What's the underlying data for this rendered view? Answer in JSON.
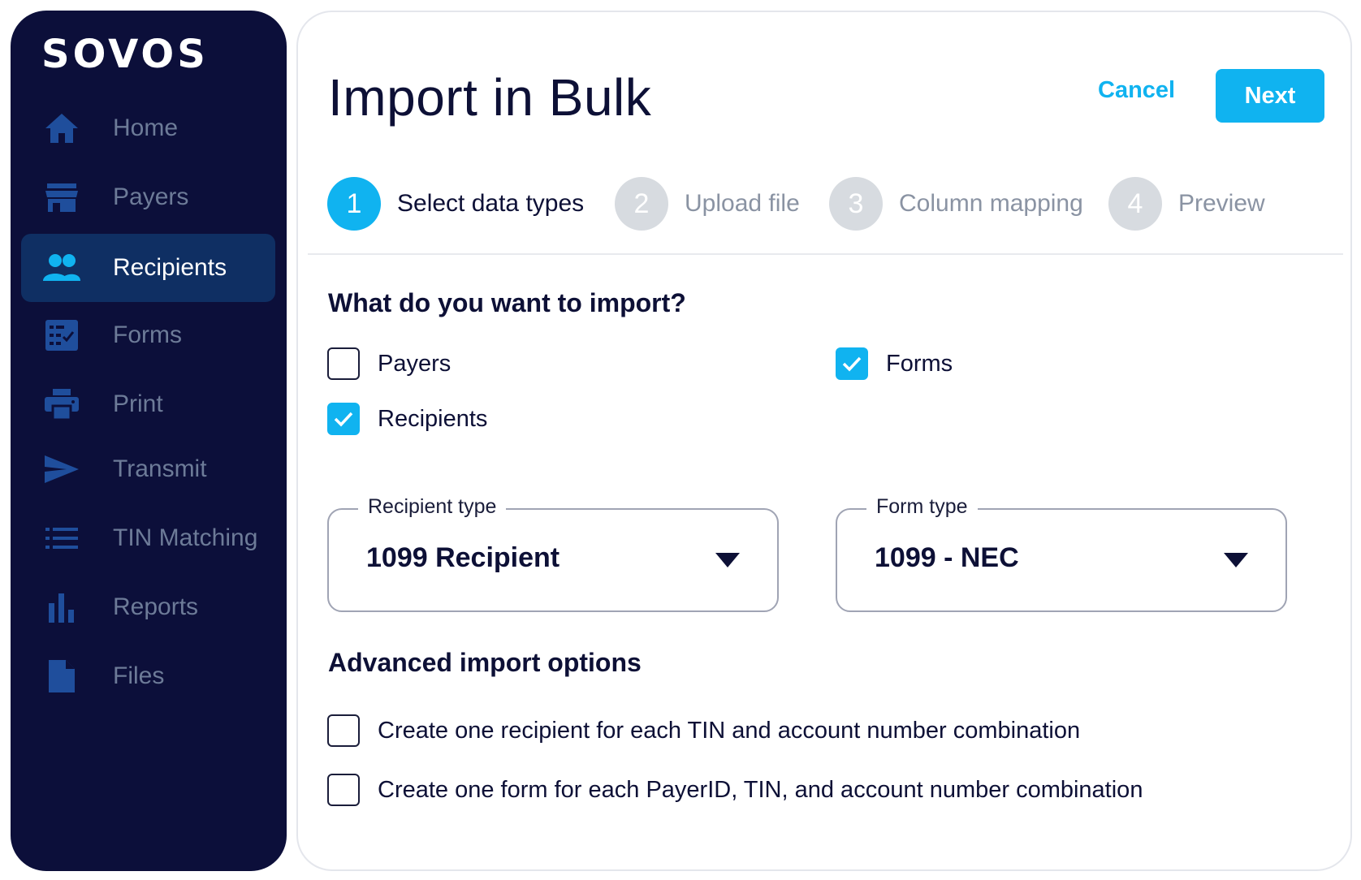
{
  "brand": {
    "logo_text": "SOVOS"
  },
  "sidebar": {
    "items": [
      {
        "label": "Home",
        "icon": "home-icon",
        "active": false
      },
      {
        "label": "Payers",
        "icon": "store-icon",
        "active": false
      },
      {
        "label": "Recipients",
        "icon": "people-icon",
        "active": true
      },
      {
        "label": "Forms",
        "icon": "checklist-icon",
        "active": false
      },
      {
        "label": "Print",
        "icon": "printer-icon",
        "active": false
      },
      {
        "label": "Transmit",
        "icon": "send-icon",
        "active": false
      },
      {
        "label": "TIN Matching",
        "icon": "list-icon",
        "active": false
      },
      {
        "label": "Reports",
        "icon": "bar-chart-icon",
        "active": false
      },
      {
        "label": "Files",
        "icon": "file-icon",
        "active": false
      }
    ]
  },
  "header": {
    "title": "Import in Bulk",
    "cancel_label": "Cancel",
    "next_label": "Next"
  },
  "stepper": {
    "steps": [
      {
        "number": "1",
        "label": "Select data types",
        "active": true
      },
      {
        "number": "2",
        "label": "Upload file",
        "active": false
      },
      {
        "number": "3",
        "label": "Column mapping",
        "active": false
      },
      {
        "number": "4",
        "label": "Preview",
        "active": false
      }
    ]
  },
  "import_section": {
    "heading": "What do you want to import?",
    "options": {
      "payers": {
        "label": "Payers",
        "checked": false
      },
      "recipients": {
        "label": "Recipients",
        "checked": true
      },
      "forms": {
        "label": "Forms",
        "checked": true
      }
    },
    "recipient_type": {
      "label": "Recipient type",
      "value": "1099 Recipient"
    },
    "form_type": {
      "label": "Form type",
      "value": "1099 - NEC"
    }
  },
  "advanced_section": {
    "heading": "Advanced import options",
    "options": [
      {
        "label": "Create one recipient for each TIN and account number combination",
        "checked": false
      },
      {
        "label": "Create one form for each PayerID, TIN, and account number combination",
        "checked": false
      }
    ]
  },
  "colors": {
    "sidebar_bg": "#0c0f3a",
    "sidebar_active_bg": "#0f2f63",
    "accent": "#10b3f0",
    "icon_blue": "#1f4e9c",
    "text_dark": "#0d1036"
  }
}
